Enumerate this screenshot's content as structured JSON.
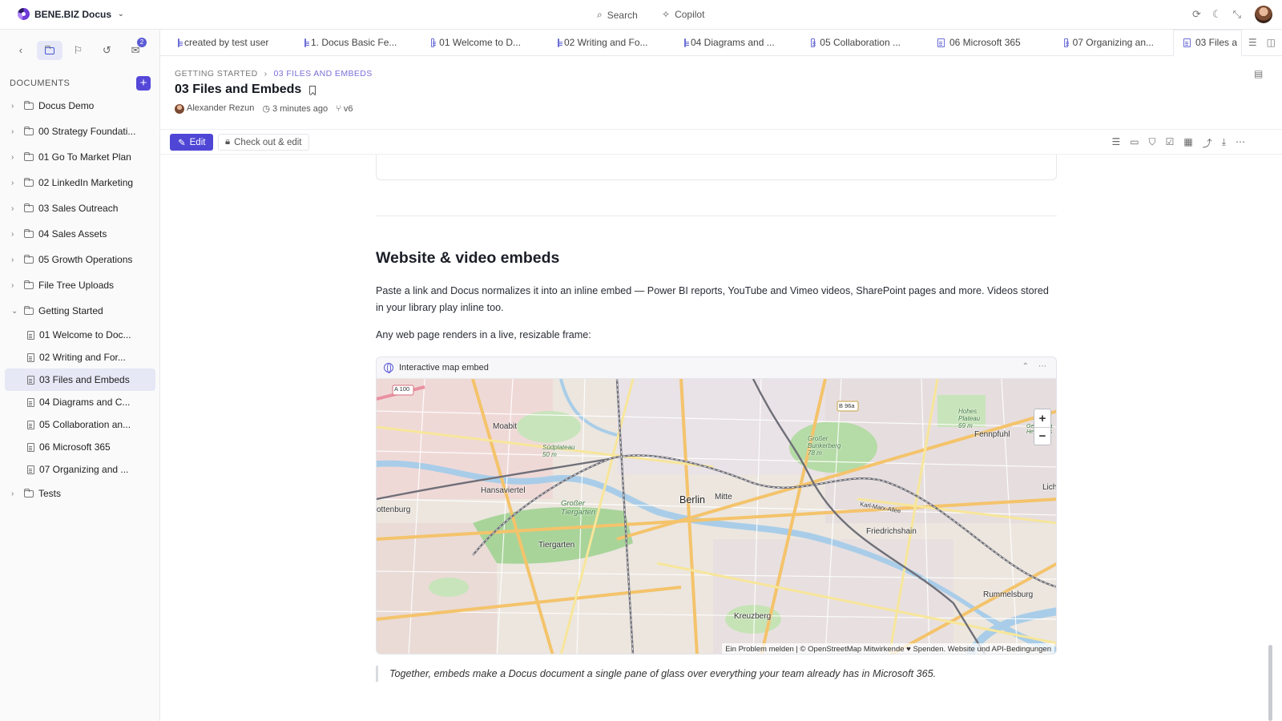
{
  "app": {
    "brand": "BENE.BIZ Docus",
    "search_label": "Search",
    "copilot_label": "Copilot"
  },
  "sidebar": {
    "notification_count": "2",
    "documents_label": "DOCUMENTS",
    "tree": [
      {
        "label": "Docus Demo",
        "type": "folder",
        "expanded": false
      },
      {
        "label": "00 Strategy Foundati...",
        "type": "folder",
        "expanded": false
      },
      {
        "label": "01 Go To Market Plan",
        "type": "folder",
        "expanded": false
      },
      {
        "label": "02 LinkedIn Marketing",
        "type": "folder",
        "expanded": false
      },
      {
        "label": "03 Sales Outreach",
        "type": "folder",
        "expanded": false
      },
      {
        "label": "04 Sales Assets",
        "type": "folder",
        "expanded": false
      },
      {
        "label": "05 Growth Operations",
        "type": "folder",
        "expanded": false
      },
      {
        "label": "File Tree Uploads",
        "type": "folder",
        "expanded": false
      },
      {
        "label": "Getting Started",
        "type": "folder",
        "expanded": true
      },
      {
        "label": "01 Welcome to Doc...",
        "type": "doc"
      },
      {
        "label": "02 Writing and For...",
        "type": "doc"
      },
      {
        "label": "03 Files and Embeds",
        "type": "doc",
        "selected": true
      },
      {
        "label": "04 Diagrams and C...",
        "type": "doc"
      },
      {
        "label": "05 Collaboration an...",
        "type": "doc"
      },
      {
        "label": "06 Microsoft 365",
        "type": "doc"
      },
      {
        "label": "07 Organizing and ...",
        "type": "doc"
      },
      {
        "label": "Tests",
        "type": "folder",
        "expanded": false
      }
    ]
  },
  "tabs": [
    {
      "label": "created by test user"
    },
    {
      "label": "1. Docus Basic Fe..."
    },
    {
      "label": "01 Welcome to D..."
    },
    {
      "label": "02 Writing and Fo..."
    },
    {
      "label": "04 Diagrams and ..."
    },
    {
      "label": "05 Collaboration ..."
    },
    {
      "label": "06 Microsoft 365"
    },
    {
      "label": "07 Organizing an..."
    },
    {
      "label": "03 Files a",
      "active": true
    }
  ],
  "document": {
    "breadcrumb_parent": "GETTING STARTED",
    "breadcrumb_current": "03 FILES AND EMBEDS",
    "title": "03 Files and Embeds",
    "author": "Alexander Rezun",
    "modified": "3 minutes ago",
    "version": "v6"
  },
  "toolbar": {
    "edit_label": "Edit",
    "checkout_label": "Check out & edit"
  },
  "content": {
    "section_title": "Website & video embeds",
    "paragraph1": "Paste a link and Docus normalizes it into an inline embed — Power BI reports, YouTube and Vimeo videos, SharePoint pages and more. Videos stored in your library play inline too.",
    "paragraph2": "Any web page renders in a live, resizable frame:",
    "embed_title": "Interactive map embed",
    "quote": "Together, embeds make a Docus document a single pane of glass over everything your team already has in Microsoft 365."
  },
  "map": {
    "zoom_in": "+",
    "zoom_out": "−",
    "attribution": "Ein Problem melden | © OpenStreetMap Mitwirkende ♥ Spenden. Website und API-Bedingungen",
    "labels": {
      "berlin": "Berlin",
      "mitte": "Mitte",
      "moabit": "Moabit",
      "hansaviertel": "Hansaviertel",
      "tiergarten": "Tiergarten",
      "grosser_tiergarten": "Großer Tiergarten",
      "kreuzberg": "Kreuzberg",
      "friedrichshain": "Friedrichshain",
      "rummelsburg": "Rummelsburg",
      "fennpfuhl": "Fennpfuhl",
      "charlottenburg": "ottenburg",
      "lichtenberg": "Lich",
      "a100": "A 100",
      "b96a": "B 96a",
      "karl_marx_allee": "Karl-Marx-Allee",
      "bunkerberg": "Großer Bunkerberg 78 m",
      "suedplateau": "Südplateau 50 m",
      "hohes_plateau": "Hohes Plateau 69 m",
      "gewerbegebiet": "Gewerbeg. Herzbergs"
    }
  },
  "colors": {
    "accent": "#4f46d6",
    "selected_bg": "#e6e8f5"
  }
}
